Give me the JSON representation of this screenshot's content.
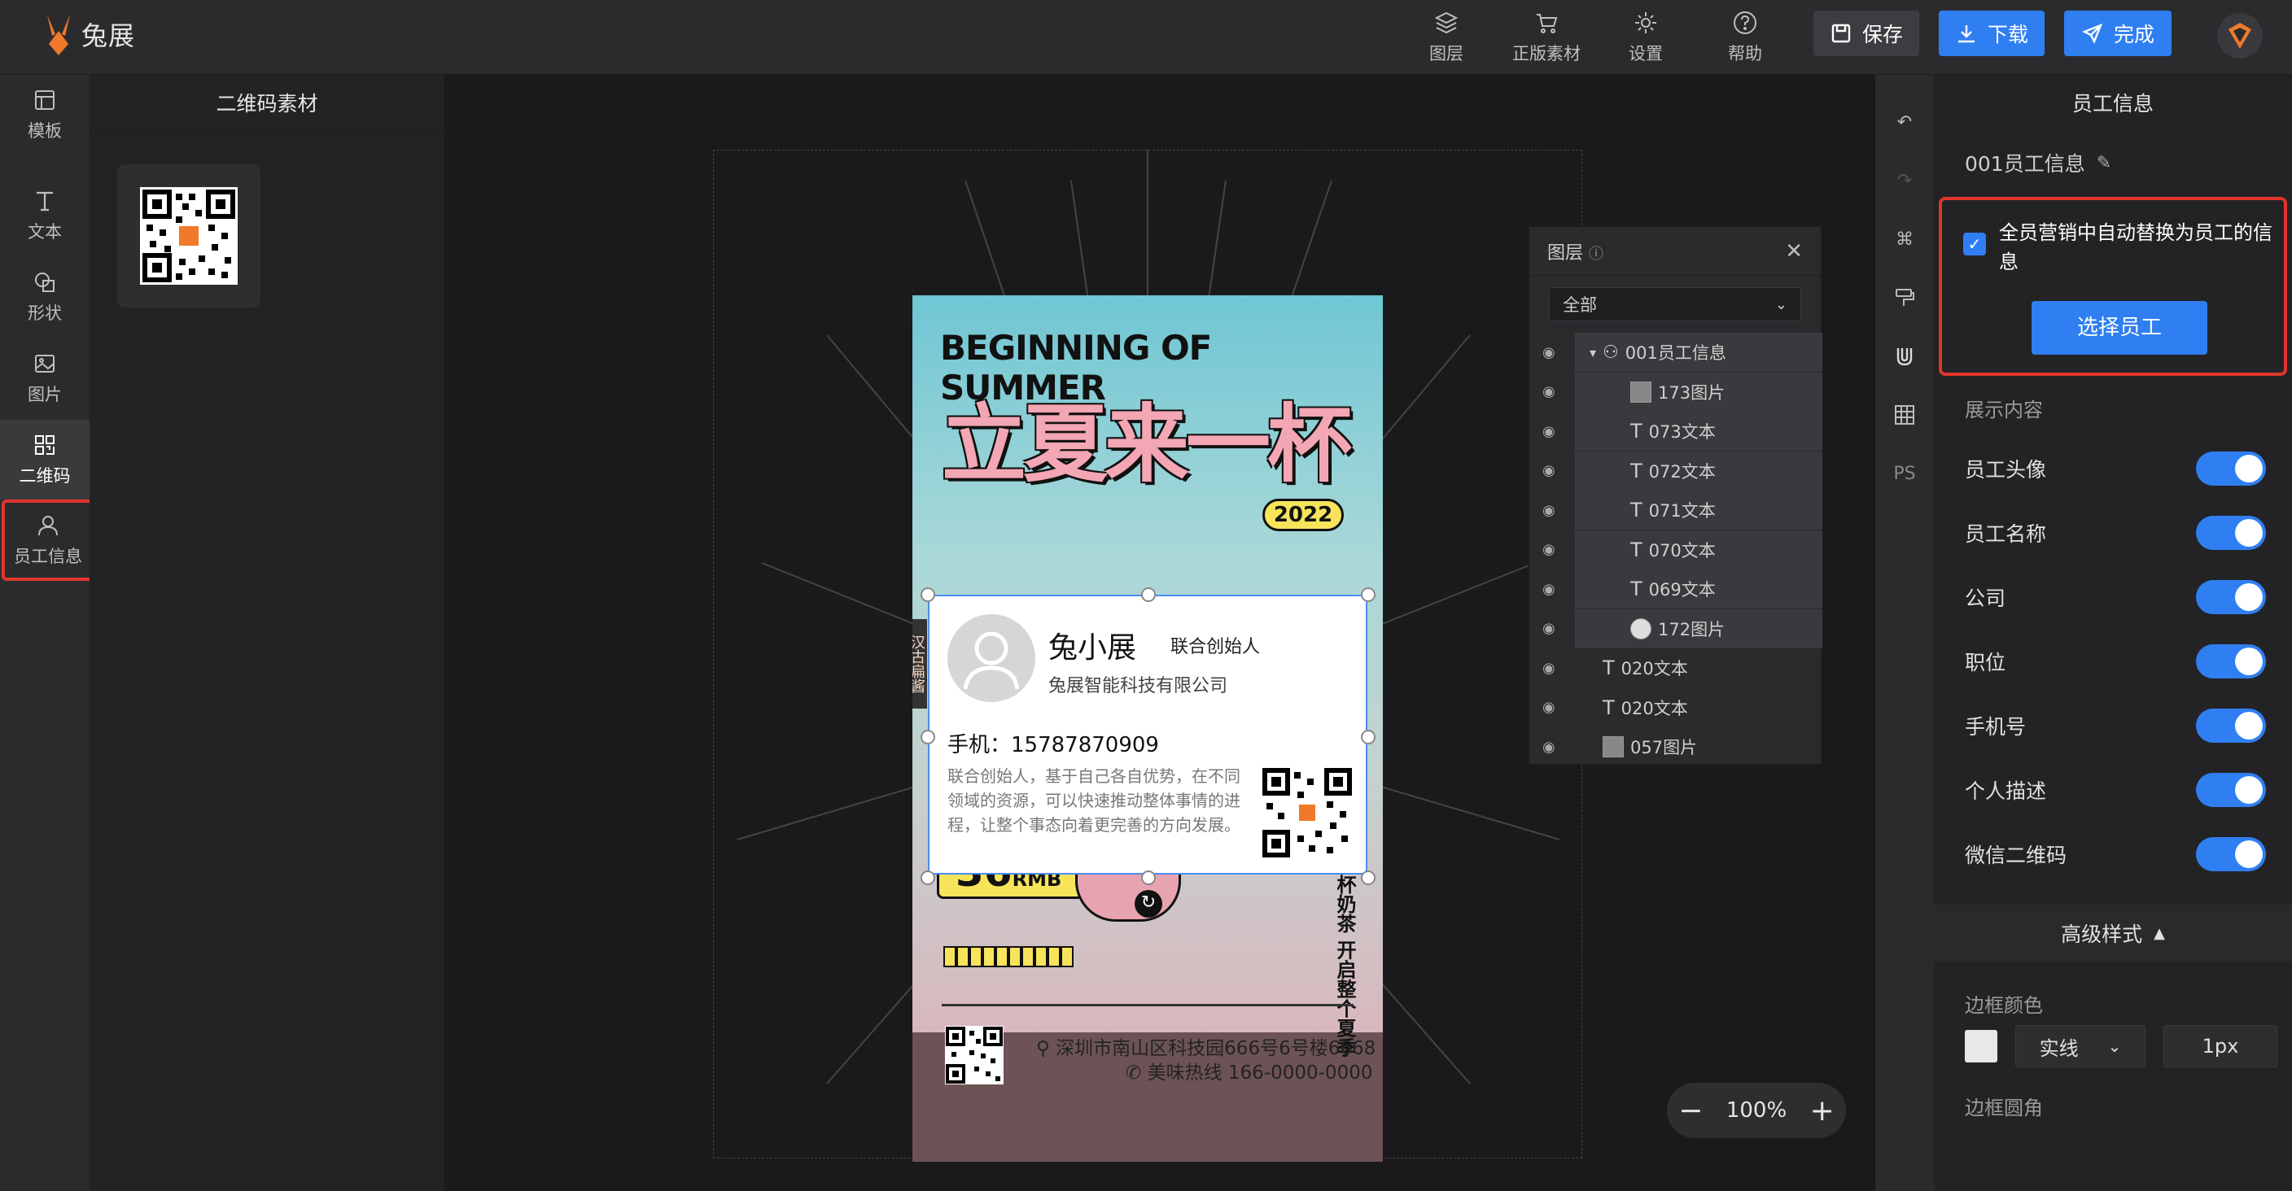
{
  "app": {
    "name": "兔展"
  },
  "toolbar": {
    "tools": [
      {
        "label": "图层",
        "icon": "layers-icon"
      },
      {
        "label": "正版素材",
        "icon": "cart-icon"
      },
      {
        "label": "设置",
        "icon": "gear-icon"
      },
      {
        "label": "帮助",
        "icon": "help-icon"
      }
    ],
    "save_label": "保存",
    "download_label": "下载",
    "finish_label": "完成"
  },
  "leftnav": {
    "items": [
      {
        "label": "模板",
        "icon": "template-icon"
      },
      {
        "label": "文本",
        "icon": "text-icon"
      },
      {
        "label": "形状",
        "icon": "shape-icon"
      },
      {
        "label": "图片",
        "icon": "image-icon"
      },
      {
        "label": "二维码",
        "icon": "qrcode-icon"
      },
      {
        "label": "员工信息",
        "icon": "user-icon"
      }
    ],
    "active": "二维码"
  },
  "leftpanel": {
    "title": "二维码素材"
  },
  "poster": {
    "title_en": "BEGINNING OF SUMMER",
    "title_cn": "立夏来一杯",
    "year": "2022",
    "price": "36",
    "price_unit": "RMB",
    "vertical_text": "夏至一杯奶茶 开启整个夏季",
    "side_tag": "汉古扁酱",
    "address": "深圳市南山区科技园666号6号楼6668",
    "hotline": "美味热线 166-0000-0000"
  },
  "staff_card": {
    "name": "兔小展",
    "position": "联合创始人",
    "company": "兔展智能科技有限公司",
    "phone": "手机：15787870909",
    "description": "联合创始人，基于自己各自优势，在不同领域的资源，可以快速推动整体事情的进程，让整个事态向着更完善的方向发展。"
  },
  "layers": {
    "title": "图层",
    "filter": "全部",
    "rows": [
      {
        "label": "001员工信息",
        "type": "group"
      },
      {
        "label": "173图片",
        "type": "image"
      },
      {
        "label": "073文本",
        "type": "text"
      },
      {
        "label": "072文本",
        "type": "text"
      },
      {
        "label": "071文本",
        "type": "text"
      },
      {
        "label": "070文本",
        "type": "text"
      },
      {
        "label": "069文本",
        "type": "text"
      },
      {
        "label": "172图片",
        "type": "image"
      },
      {
        "label": "020文本",
        "type": "text"
      },
      {
        "label": "020文本",
        "type": "text"
      },
      {
        "label": "057图片",
        "type": "image"
      }
    ]
  },
  "zoom": {
    "level": "100%"
  },
  "rightpanel": {
    "title": "员工信息",
    "layer_name": "001员工信息",
    "auto_replace_label": "全员营销中自动替换为员工的信息",
    "auto_replace_checked": true,
    "select_staff_label": "选择员工",
    "display_section": "展示内容",
    "toggles": [
      {
        "label": "员工头像",
        "on": true
      },
      {
        "label": "员工名称",
        "on": true
      },
      {
        "label": "公司",
        "on": true
      },
      {
        "label": "职位",
        "on": true
      },
      {
        "label": "手机号",
        "on": true
      },
      {
        "label": "个人描述",
        "on": true
      },
      {
        "label": "微信二维码",
        "on": true
      }
    ],
    "advanced_label": "高级样式",
    "border_color_label": "边框颜色",
    "border_style": "实线",
    "border_width": "1px",
    "border_radius_label": "边框圆角"
  },
  "righttools": {
    "ps_label": "PS"
  },
  "colors": {
    "accent": "#2f7ff2",
    "highlight": "#e0352b"
  }
}
